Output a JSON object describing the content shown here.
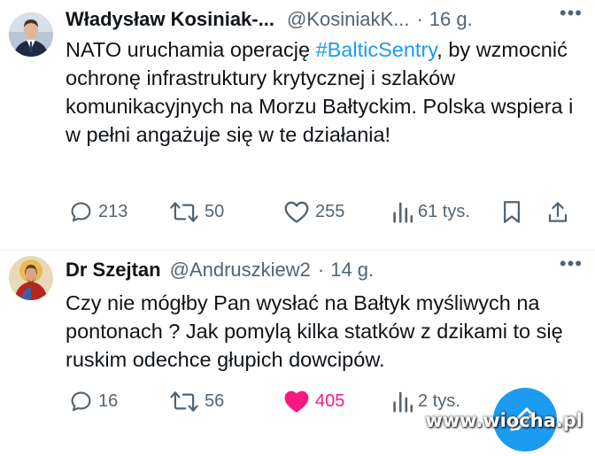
{
  "tweets": [
    {
      "author": "Władysław Kosiniak-...",
      "handle": "@KosiniakK...",
      "time": "16 g.",
      "text_parts": [
        "NATO uruchamia operację ",
        "#BalticSentry",
        ", by wzmocnić ochronę infrastruktury krytycznej i szlaków komunikacyjnych na Morzu Bałtyckim. Polska wspiera i w pełni angażuje się w te działania!"
      ],
      "replies": "213",
      "retweets": "50",
      "likes": "255",
      "views": "61 tys.",
      "liked": false
    },
    {
      "author": "Dr Szejtan",
      "handle": "@Andruszkiew2",
      "time": "14 g.",
      "text": "Czy nie mógłby Pan wysłać na Bałtyk myśliwych na pontonach ? Jak pomylą kilka statków z dzikami to się ruskim odechce głupich dowcipów.",
      "replies": "16",
      "retweets": "56",
      "likes": "405",
      "views": "2 tys.",
      "liked": true
    }
  ],
  "more_glyph": "•••",
  "separator": "·",
  "watermark": "www.wiocha.pl",
  "colors": {
    "accent": "#1d9bf0",
    "like": "#f91880",
    "muted": "#536471",
    "text": "#0f1419"
  },
  "icons": [
    "reply-icon",
    "retweet-icon",
    "like-icon",
    "views-icon",
    "bookmark-icon",
    "share-icon",
    "compose-icon"
  ]
}
